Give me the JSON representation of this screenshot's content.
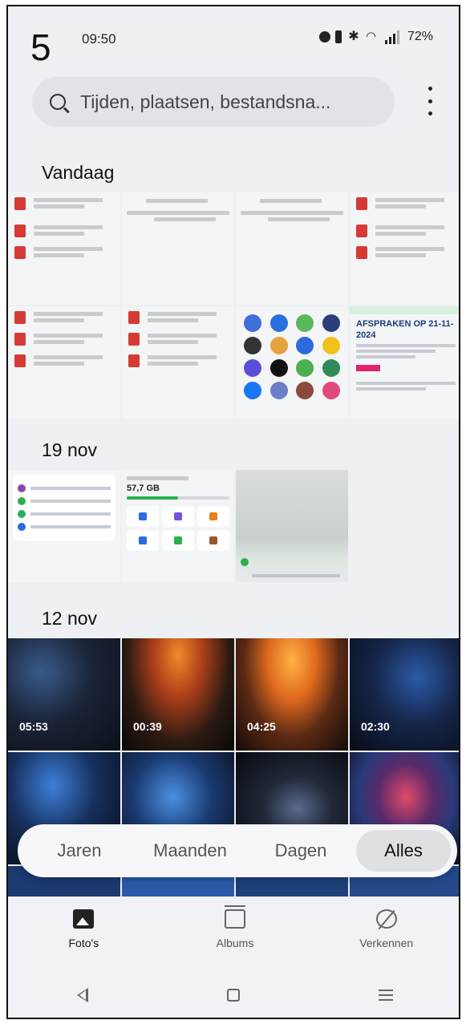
{
  "annotation": {
    "step": "5"
  },
  "status_bar": {
    "time": "09:50",
    "battery": "72%"
  },
  "search": {
    "placeholder": "Tijden, plaatsen, bestandsna..."
  },
  "sections": [
    {
      "title": "Vandaag"
    },
    {
      "title": "19 nov"
    },
    {
      "title": "12 nov"
    }
  ],
  "thumbnails": {
    "storage_value": "57,7 GB",
    "afspraken_title": "AFSPRAKEN OP 21-11-2024"
  },
  "videos": [
    {
      "duration": "05:53"
    },
    {
      "duration": "00:39"
    },
    {
      "duration": "04:25"
    },
    {
      "duration": "02:30"
    }
  ],
  "view_selector": {
    "options": [
      "Jaren",
      "Maanden",
      "Dagen",
      "Alles"
    ],
    "selected": "Alles"
  },
  "bottom_nav": {
    "items": [
      {
        "label": "Foto's",
        "icon": "photos-icon",
        "active": true
      },
      {
        "label": "Albums",
        "icon": "albums-icon",
        "active": false
      },
      {
        "label": "Verkennen",
        "icon": "explore-icon",
        "active": false
      }
    ]
  },
  "colors": {
    "accent": "#2bb04b",
    "pdf_red": "#d63a35",
    "background": "#eef0f3"
  }
}
